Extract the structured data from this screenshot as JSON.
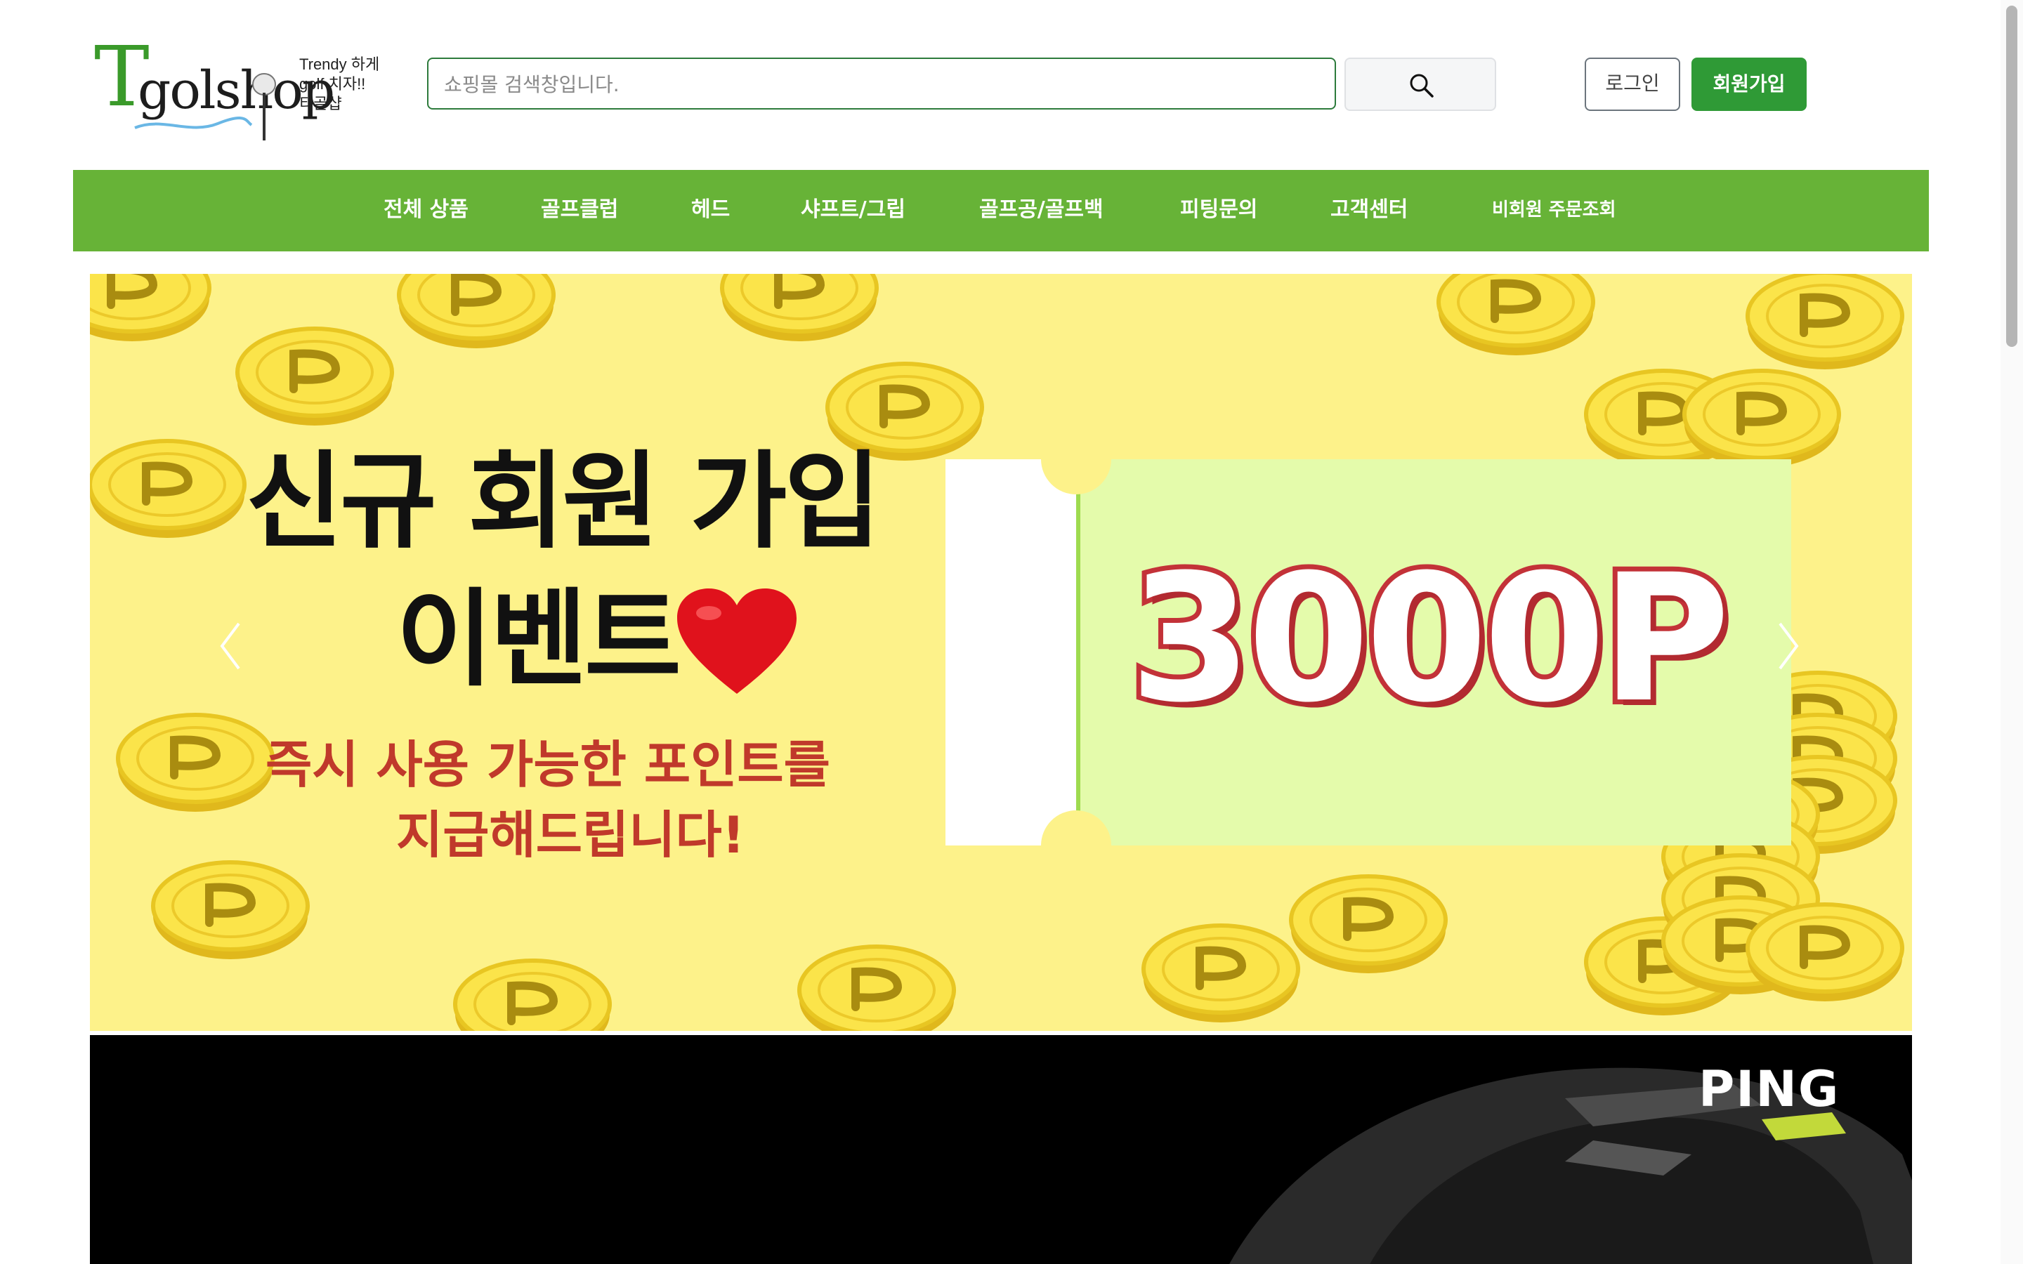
{
  "logo": {
    "letter": "T",
    "wordmark": "golshop",
    "tagline": [
      "Trendy 하게",
      "golf 치자!!",
      "티골샵"
    ]
  },
  "search": {
    "placeholder": "쇼핑몰 검색창입니다.",
    "button_icon": "search-icon"
  },
  "auth": {
    "login_label": "로그인",
    "signup_label": "회원가입"
  },
  "nav": {
    "items": [
      "전체 상품",
      "골프클럽",
      "헤드",
      "샤프트/그립",
      "골프공/골프백",
      "피팅문의",
      "고객센터",
      "비회원 주문조회"
    ]
  },
  "banner": {
    "headline_line1": "신규 회원 가입",
    "headline_line2": "이벤트",
    "sub_line1": "즉시 사용 가능한 포인트를",
    "sub_line2": "지급해드립니다!",
    "points": "3000P",
    "prev_icon": "chevron-left-icon",
    "next_icon": "chevron-right-icon"
  },
  "banner2": {
    "brand": "PING"
  },
  "colors": {
    "nav_green": "#67b337",
    "signup_green": "#2f9a36",
    "banner_yellow": "#fdf28a",
    "points_red": "#c33238"
  }
}
